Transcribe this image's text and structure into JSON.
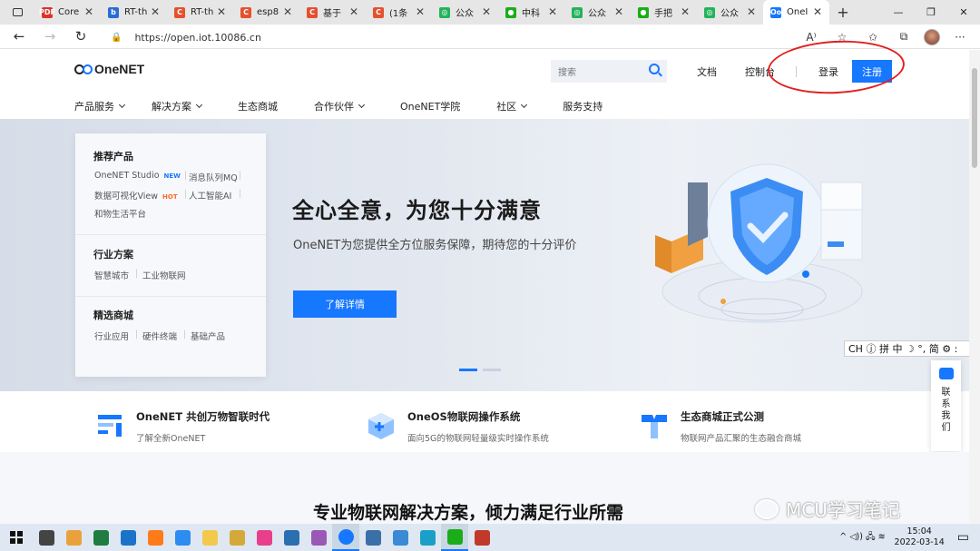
{
  "browser": {
    "tabs": [
      {
        "title": "Core",
        "color": "#d9342b",
        "glyph": "PDF"
      },
      {
        "title": "RT-th",
        "color": "#2a6cd6",
        "glyph": "b"
      },
      {
        "title": "RT-th",
        "color": "#e5502e",
        "glyph": "C"
      },
      {
        "title": "esp8",
        "color": "#e5502e",
        "glyph": "C"
      },
      {
        "title": "基于",
        "color": "#e5502e",
        "glyph": "C"
      },
      {
        "title": "(1条",
        "color": "#e5502e",
        "glyph": "C"
      },
      {
        "title": "公众",
        "color": "#24b35b",
        "glyph": "◎"
      },
      {
        "title": "中科",
        "color": "#1aad19",
        "glyph": "●"
      },
      {
        "title": "公众",
        "color": "#24b35b",
        "glyph": "◎"
      },
      {
        "title": "手把",
        "color": "#1aad19",
        "glyph": "●"
      },
      {
        "title": "公众",
        "color": "#24b35b",
        "glyph": "◎"
      },
      {
        "title": "OneI",
        "color": "#1677ff",
        "glyph": "Oo",
        "active": true
      }
    ],
    "url": "https://open.iot.10086.cn"
  },
  "header": {
    "logo_text": "OneNET",
    "search_placeholder": "搜索",
    "docs": "文档",
    "console": "控制台",
    "login": "登录",
    "register": "注册",
    "nav": [
      {
        "label": "产品服务",
        "dropdown": true
      },
      {
        "label": "解决方案",
        "dropdown": true
      },
      {
        "label": "生态商城",
        "dropdown": false
      },
      {
        "label": "合作伙伴",
        "dropdown": true
      },
      {
        "label": "OneNET学院",
        "dropdown": false
      },
      {
        "label": "社区",
        "dropdown": true
      },
      {
        "label": "服务支持",
        "dropdown": false
      }
    ]
  },
  "sidecard": {
    "recommended_title": "推荐产品",
    "studio": "OneNET Studio",
    "new_tag": "NEW",
    "mq": "消息队列MQ",
    "view": "数据可视化View",
    "hot_tag": "HOT",
    "ai": "人工智能AI",
    "life": "和物生活平台",
    "industry_title": "行业方案",
    "smart_city": "智慧城市",
    "industrial_iot": "工业物联网",
    "mall_title": "精选商城",
    "apps": "行业应用",
    "hardware": "硬件终端",
    "basic": "基础产品"
  },
  "hero": {
    "title": "全心全意，为您十分满意",
    "subtitle": "OneNET为您提供全方位服务保障，期待您的十分评价",
    "button": "了解详情"
  },
  "features": [
    {
      "title": "OneNET 共创万物智联时代",
      "desc": "了解全新OneNET"
    },
    {
      "title": "OneOS物联网操作系统",
      "desc": "面向5G的物联网轻量级实时操作系统"
    },
    {
      "title": "生态商城正式公测",
      "desc": "物联网产品汇聚的生态融合商城"
    }
  ],
  "section_title": "专业物联网解决方案，倾力满足行业所需",
  "contact_label": "联系我们",
  "ime_text": "CH ⓙ 拼 中 ☽ °, 简 ⚙ :",
  "watermark": "MCU学习笔记",
  "taskbar": {
    "time": "15:04",
    "date": "2022-03-14",
    "tray": "^ ◁)) 🖧 ≋"
  },
  "colors": {
    "accent": "#1677ff",
    "annotation": "#e02020"
  }
}
